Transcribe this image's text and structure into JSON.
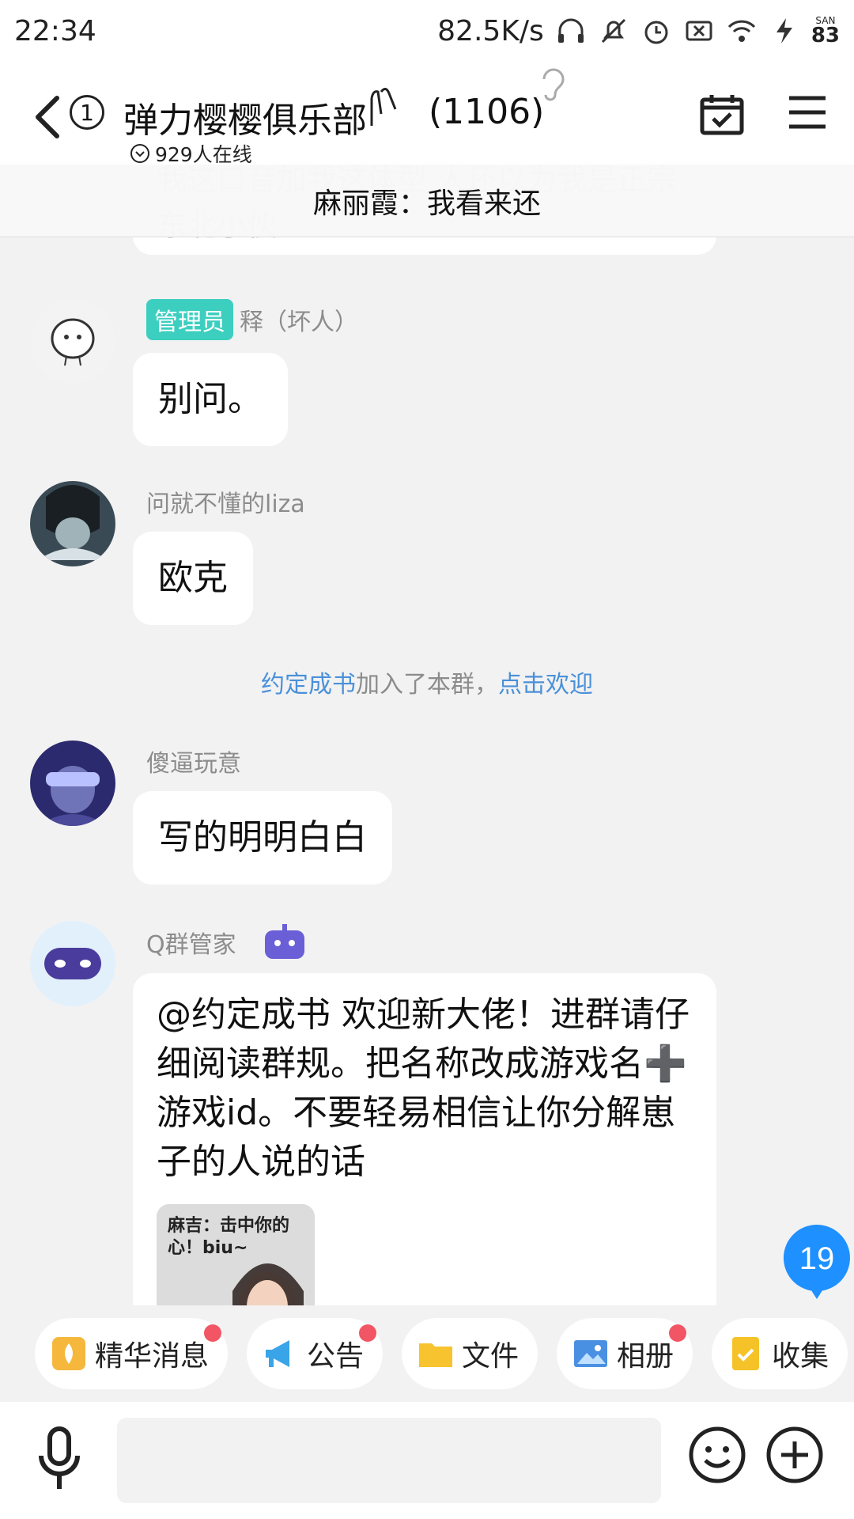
{
  "status_bar": {
    "time": "22:34",
    "speed": "82.5K/s",
    "icons": [
      "headphones-icon",
      "bell-off-icon",
      "alarm-icon",
      "sim-x-icon",
      "wifi-icon",
      "battery-charging-icon"
    ],
    "san_label": "SAN",
    "battery": "83"
  },
  "header": {
    "unread": "1",
    "title": "弹力樱樱俱乐部",
    "member_count": "(1106)",
    "online": "929人在线"
  },
  "pinned": {
    "text": "麻丽霞：我看来还",
    "ghost_text": "我这口音加我这体型 人还以为我是正宗东北小伙"
  },
  "messages": [
    {
      "sender": "释（坏人）",
      "role": "管理员",
      "text": "别问。"
    },
    {
      "sender": "问就不懂的liza",
      "text": "欧克"
    },
    {
      "sender": "傻逼玩意",
      "text": "写的明明白白"
    },
    {
      "sender": "Q群管家",
      "text": "@约定成书 欢迎新大佬！进群请仔细阅读群规。把名称改成游戏名➕游戏id。不要轻易相信让你分解崽子的人说的话",
      "sticker_caption": "麻吉：击中你的心！biu~"
    }
  ],
  "system": {
    "name": "约定成书",
    "middle": "加入了本群，",
    "action": "点击欢迎"
  },
  "unread_badge": "19",
  "quickbar": [
    {
      "label": "精华消息",
      "icon": "essence-icon",
      "dot": true
    },
    {
      "label": "公告",
      "icon": "megaphone-icon",
      "dot": true
    },
    {
      "label": "文件",
      "icon": "folder-icon",
      "dot": false
    },
    {
      "label": "相册",
      "icon": "album-icon",
      "dot": true
    },
    {
      "label": "收集",
      "icon": "collect-icon",
      "dot": false
    }
  ],
  "input": {
    "placeholder": ""
  },
  "colors": {
    "admin_badge": "#3ccfc0",
    "link": "#4a90d9",
    "badge": "#1e90ff",
    "dot": "#f25564"
  }
}
